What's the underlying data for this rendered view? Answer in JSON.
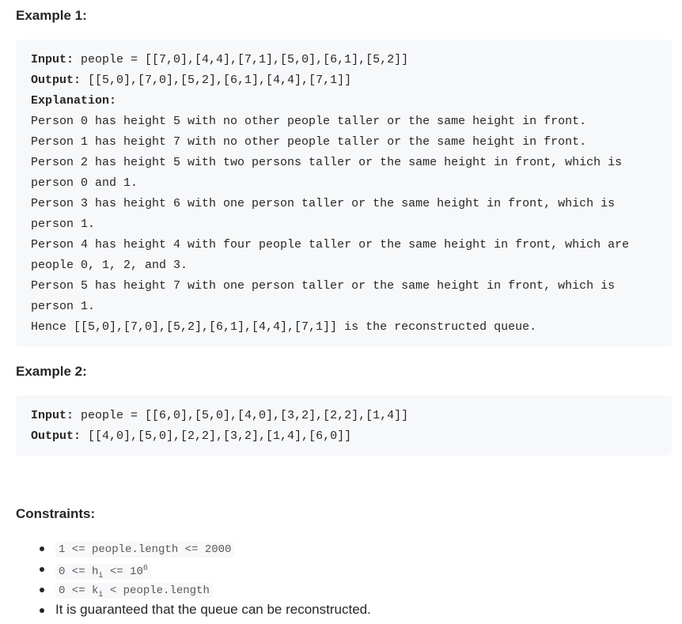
{
  "example1": {
    "title": "Example 1:",
    "input_label": "Input:",
    "input_value": " people = [[7,0],[4,4],[7,1],[5,0],[6,1],[5,2]]",
    "output_label": "Output:",
    "output_value": " [[5,0],[7,0],[5,2],[6,1],[4,4],[7,1]]",
    "explanation_label": "Explanation:",
    "explanation_lines": [
      "Person 0 has height 5 with no other people taller or the same height in front.",
      "Person 1 has height 7 with no other people taller or the same height in front.",
      "Person 2 has height 5 with two persons taller or the same height in front, which is",
      "person 0 and 1.",
      "Person 3 has height 6 with one person taller or the same height in front, which is",
      "person 1.",
      "Person 4 has height 4 with four people taller or the same height in front, which are",
      "people 0, 1, 2, and 3.",
      "Person 5 has height 7 with one person taller or the same height in front, which is",
      "person 1.",
      "Hence [[5,0],[7,0],[5,2],[6,1],[4,4],[7,1]] is the reconstructed queue."
    ]
  },
  "example2": {
    "title": "Example 2:",
    "input_label": "Input:",
    "input_value": " people = [[6,0],[5,0],[4,0],[3,2],[2,2],[1,4]]",
    "output_label": "Output:",
    "output_value": " [[4,0],[5,0],[2,2],[3,2],[1,4],[6,0]]"
  },
  "constraints": {
    "title": "Constraints:",
    "c1": "1 <= people.length <= 2000",
    "c2_a": "0 <= h",
    "c2_sub": "i",
    "c2_b": " <= 10",
    "c2_sup": "6",
    "c3_a": "0 <= k",
    "c3_sub": "i",
    "c3_b": " < people.length",
    "c4": "It is guaranteed that the queue can be reconstructed."
  }
}
